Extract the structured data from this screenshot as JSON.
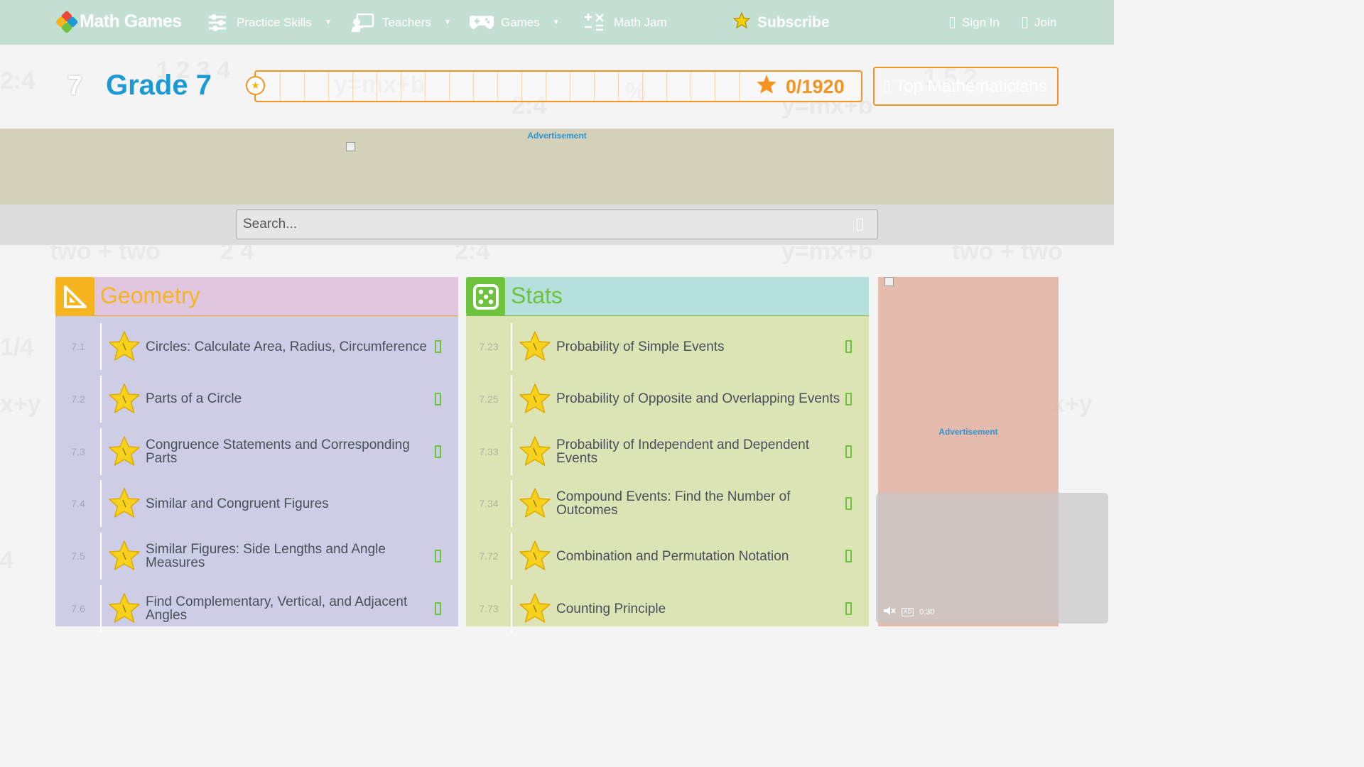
{
  "brand": {
    "name": "Math Games"
  },
  "nav": {
    "items": [
      {
        "label": "Practice Skills",
        "has_caret": true
      },
      {
        "label": "Teachers",
        "has_caret": true
      },
      {
        "label": "Games",
        "has_caret": true
      },
      {
        "label": "Math Jam",
        "has_caret": false
      }
    ],
    "subscribe": "Subscribe",
    "sign_in": "Sign In",
    "join": "Join"
  },
  "grade": {
    "number": "7",
    "title": "Grade 7",
    "score": "0/1920",
    "progress_fraction": 0,
    "top_button": "Top Mathematicians"
  },
  "ads": {
    "label": "Advertisement"
  },
  "search": {
    "placeholder": "Search..."
  },
  "panels": {
    "geometry": {
      "title": "Geometry",
      "skills": [
        {
          "code": "7.1",
          "label": "Circles: Calculate Area, Radius, Circumference"
        },
        {
          "code": "7.2",
          "label": "Parts of a Circle"
        },
        {
          "code": "7.3",
          "label": "Congruence Statements and Corresponding Parts"
        },
        {
          "code": "7.4",
          "label": "Similar and Congruent Figures"
        },
        {
          "code": "7.5",
          "label": "Similar Figures: Side Lengths and Angle Measures"
        },
        {
          "code": "7.6",
          "label": "Find Complementary, Vertical, and Adjacent Angles"
        }
      ]
    },
    "stats": {
      "title": "Stats",
      "skills": [
        {
          "code": "7.23",
          "label": "Probability of Simple Events"
        },
        {
          "code": "7.25",
          "label": "Probability of Opposite and Overlapping Events"
        },
        {
          "code": "7.33",
          "label": "Probability of Independent and Dependent Events"
        },
        {
          "code": "7.34",
          "label": "Compound Events: Find the Number of Outcomes"
        },
        {
          "code": "7.72",
          "label": "Combination and Permutation Notation"
        },
        {
          "code": "7.73",
          "label": "Counting Principle"
        }
      ]
    }
  },
  "video": {
    "time": "0:30",
    "ad_badge": "AD"
  },
  "colors": {
    "nav_bg": "#c3e0d2",
    "accent_orange": "#f39322",
    "grade_blue": "#1c9ad6",
    "geometry": "#f6b51e",
    "stats": "#6fc23d"
  }
}
